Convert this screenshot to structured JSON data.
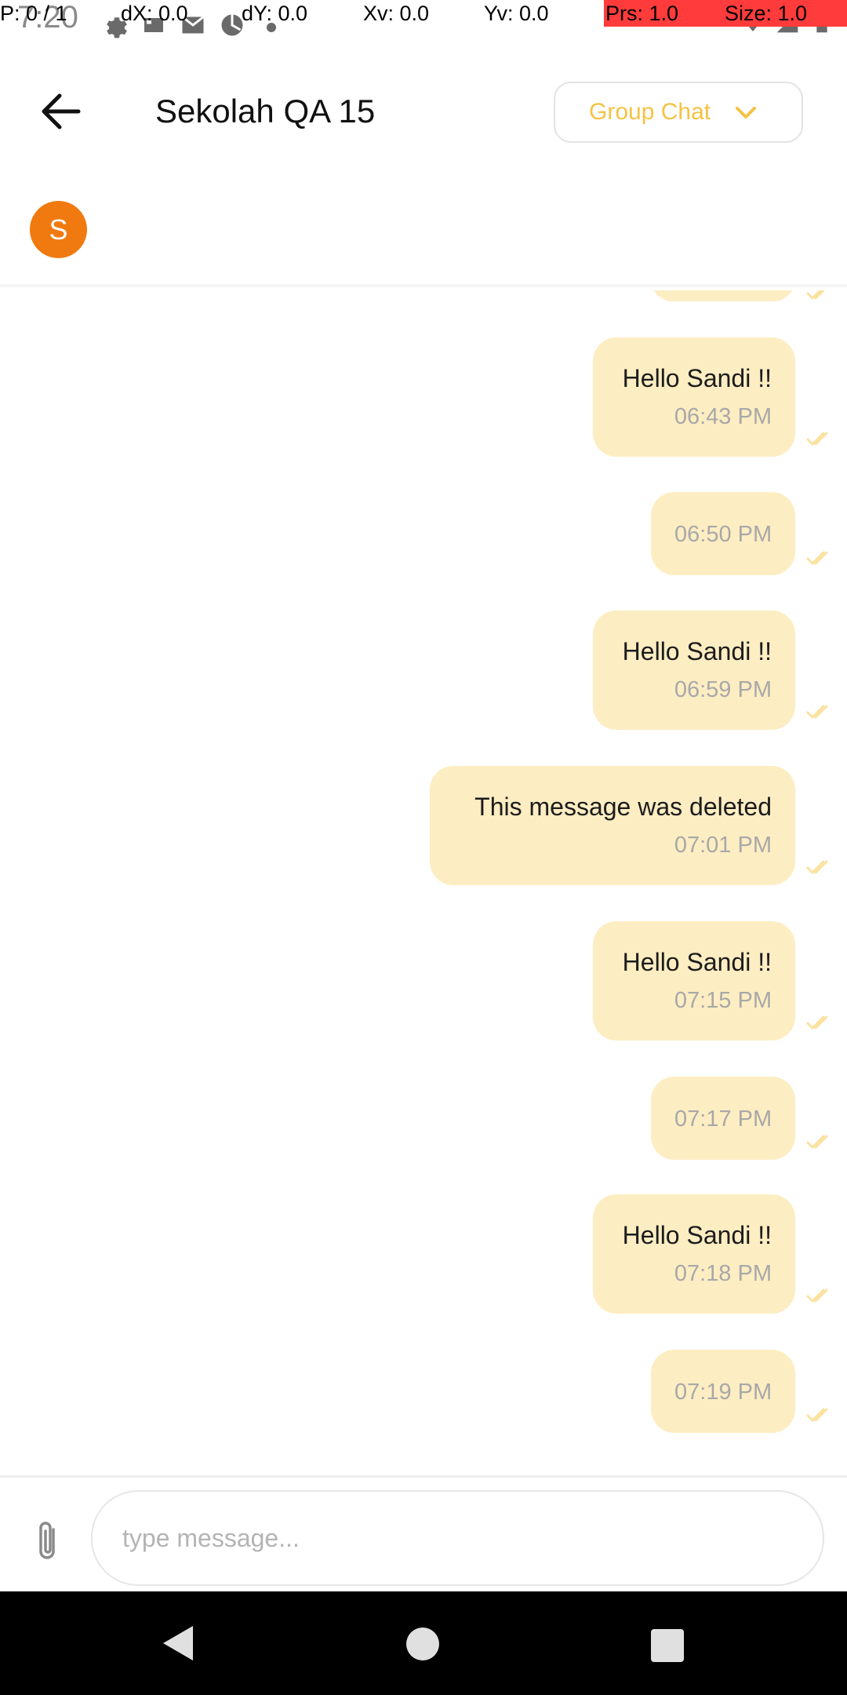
{
  "status_bar": {
    "time": "7:20"
  },
  "debug_overlay": {
    "p": "P: 0 / 1",
    "dx": "dX: 0.0",
    "dy": "dY: 0.0",
    "xv": "Xv: 0.0",
    "yv": "Yv: 0.0",
    "prs": "Prs: 1.0",
    "size": "Size: 1.0"
  },
  "header": {
    "title": "Sekolah QA 15",
    "dropdown_label": "Group Chat"
  },
  "members": {
    "avatar_initial": "S"
  },
  "messages": [
    {
      "text": "Hello Sandi !!",
      "time": "06:43 PM"
    },
    {
      "text": "",
      "time": "06:50 PM"
    },
    {
      "text": "Hello Sandi !!",
      "time": "06:59 PM"
    },
    {
      "text": "This message was deleted",
      "time": "07:01 PM"
    },
    {
      "text": "Hello Sandi !!",
      "time": "07:15 PM"
    },
    {
      "text": "",
      "time": "07:17 PM"
    },
    {
      "text": "Hello Sandi !!",
      "time": "07:18 PM"
    },
    {
      "text": "",
      "time": "07:19 PM"
    }
  ],
  "composer": {
    "placeholder": "type message..."
  },
  "colors": {
    "accent": "#f6c244",
    "bubble": "#fdedc2",
    "avatar": "#f07a0f"
  }
}
